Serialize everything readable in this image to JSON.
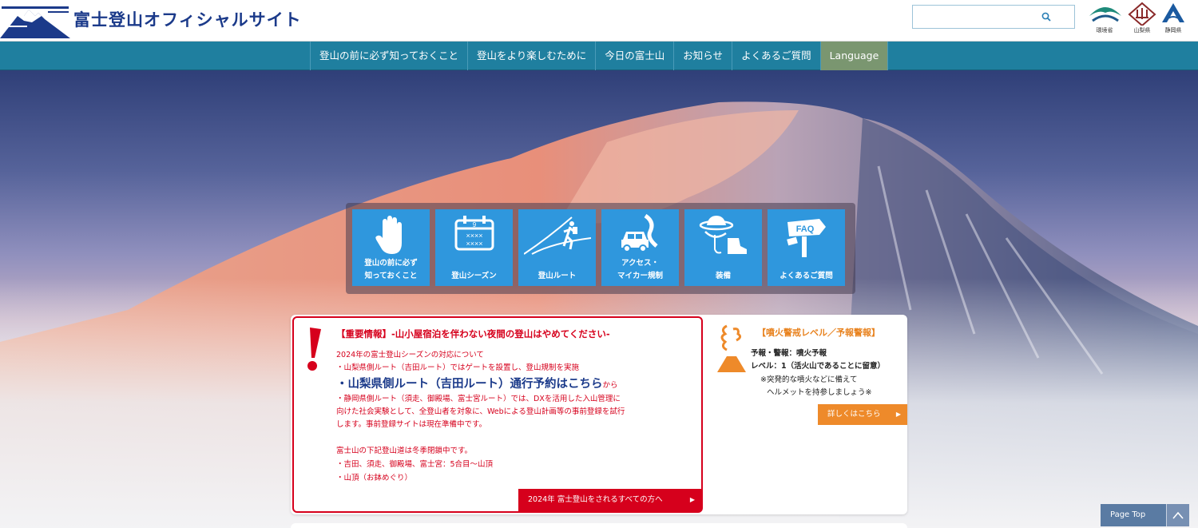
{
  "header": {
    "site_title": "富士登山オフィシャルサイト",
    "search": {
      "placeholder": "",
      "icon": "search-icon"
    },
    "prefectures": [
      {
        "label": "環境省"
      },
      {
        "label": "山梨県"
      },
      {
        "label": "静岡県"
      }
    ]
  },
  "nav": {
    "items": [
      {
        "label": "登山の前に必ず知っておくこと"
      },
      {
        "label": "登山をより楽しむために"
      },
      {
        "label": "今日の富士山"
      },
      {
        "label": "お知らせ"
      },
      {
        "label": "よくあるご質問"
      },
      {
        "label": "Language"
      }
    ]
  },
  "tiles": [
    {
      "label": "登山の前に必ず\n知っておくこと",
      "icon": "hand-icon"
    },
    {
      "label": "登山シーズン",
      "icon": "calendar-icon"
    },
    {
      "label": "登山ルート",
      "icon": "hiker-icon"
    },
    {
      "label": "アクセス・\nマイカー規制",
      "icon": "car-icon"
    },
    {
      "label": "装備",
      "icon": "gear-icon"
    },
    {
      "label": "よくあるご質問",
      "icon": "faq-sign-icon"
    }
  ],
  "notice": {
    "title": "【重要情報】-山小屋宿泊を伴わない夜間の登山はやめてください-",
    "line1": "2024年の富士登山シーズンの対応について",
    "line2": "・山梨県側ルート（吉田ルート）ではゲートを設置し、登山規制を実施",
    "big_link": "・山梨県側ルート（吉田ルート）通行予約はこちら",
    "big_suffix": "から",
    "line3": "・静岡県側ルート（須走、御殿場、富士宮ルート）では、DXを活用した入山管理に",
    "line4": "向けた社会実験として、全登山者を対象に、Webによる登山計画等の事前登録を試行",
    "line5": "します。事前登録サイトは現在準備中です。",
    "line6": "富士山の下記登山道は冬季閉鎖中です。",
    "line7": "・吉田、須走、御殿場、富士宮：5合目〜山頂",
    "line8": "・山頂（お鉢めぐり）",
    "button": "2024年 富士登山をされるすべての方へ"
  },
  "volcano": {
    "title": "【噴火警戒レベル／予報警報】",
    "line1": "予報・警報：噴火予報",
    "line2": "レベル：1（活火山であることに留意）",
    "line3": "※突発的な噴火などに備えて",
    "line4": "ヘルメットを持参しましょう※",
    "button": "詳しくはこちら"
  },
  "pagetop": {
    "label": "Page Top"
  },
  "colors": {
    "nav": "#1f7f9f",
    "tile": "#2f97dd",
    "alert": "#d6001c",
    "warning": "#ee8a2a",
    "title": "#1b3a8a"
  }
}
